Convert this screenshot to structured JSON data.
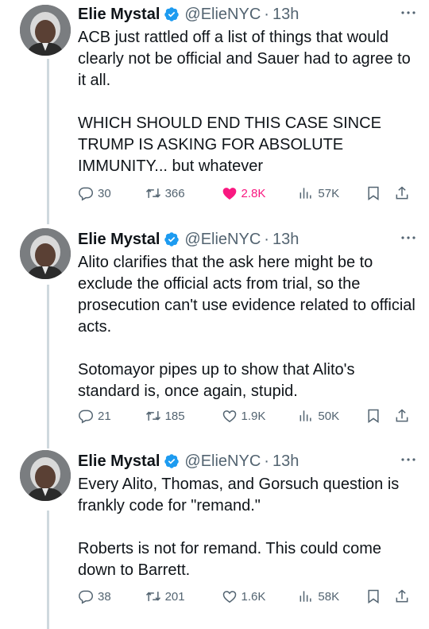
{
  "colors": {
    "verified": "#1d9bf0",
    "like": "#f91880",
    "secondary": "#536471"
  },
  "tweets": [
    {
      "name": "Elie Mystal",
      "handle": "@ElieNYC",
      "time": "13h",
      "paragraphs": [
        "ACB just rattled off a list of things that would clearly not be official and Sauer had to agree to it all.",
        "WHICH SHOULD END THIS CASE SINCE TRUMP IS ASKING FOR ABSOLUTE IMMUNITY... but whatever"
      ],
      "replies": "30",
      "reposts": "366",
      "likes": "2.8K",
      "views": "57K",
      "liked": true
    },
    {
      "name": "Elie Mystal",
      "handle": "@ElieNYC",
      "time": "13h",
      "paragraphs": [
        "Alito clarifies that the ask here might be to exclude the official acts from trial, so the prosecution can't use evidence related to official acts.",
        "Sotomayor pipes up to show that Alito's standard is, once again, stupid."
      ],
      "replies": "21",
      "reposts": "185",
      "likes": "1.9K",
      "views": "50K",
      "liked": false
    },
    {
      "name": "Elie Mystal",
      "handle": "@ElieNYC",
      "time": "13h",
      "paragraphs": [
        "Every Alito, Thomas, and Gorsuch question is frankly code for \"remand.\"",
        "Roberts is not for remand. This could come down to Barrett."
      ],
      "replies": "38",
      "reposts": "201",
      "likes": "1.6K",
      "views": "58K",
      "liked": false
    }
  ]
}
